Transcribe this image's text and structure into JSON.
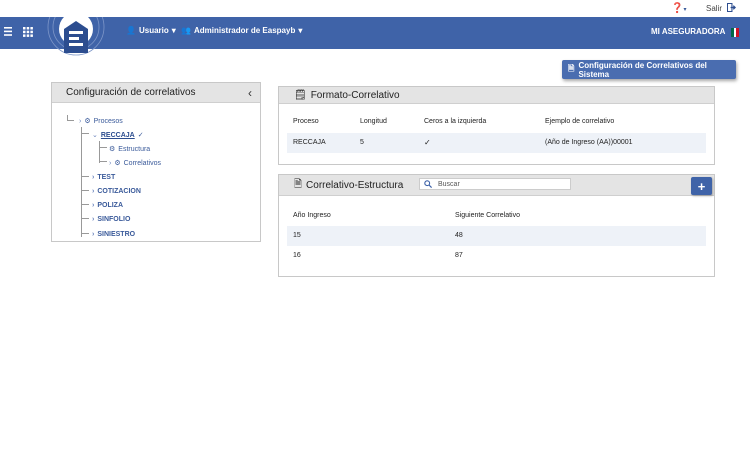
{
  "topbar": {
    "salir_label": "Salir"
  },
  "navbar": {
    "user_label": "Usuario",
    "admin_label": "Administrador de Easpayb",
    "company_label": "MI ASEGURADORA",
    "flag_colors": [
      "#006847",
      "#ffffff",
      "#ce1126"
    ]
  },
  "toolbar": {
    "system_button_label": "Configuración de Correlativos del Sistema"
  },
  "left_panel": {
    "title": "Configuración de correlativos",
    "tree": {
      "procesos": "Procesos",
      "reccaja": "RECCAJA",
      "estructura": "Estructura",
      "correlativos": "Correlativos",
      "items": [
        "TEST",
        "COTIZACION",
        "POLIZA",
        "SINFOLIO",
        "SINIESTRO"
      ]
    }
  },
  "formato": {
    "title": "Formato-Correlativo",
    "headers": {
      "proceso": "Proceso",
      "longitud": "Longitud",
      "ceros": "Ceros a la izquierda",
      "ejemplo": "Ejemplo de correlativo"
    },
    "row": {
      "proceso": "RECCAJA",
      "longitud": "5",
      "ceros": "✓",
      "ejemplo": "(Año de Ingreso (AA))00001"
    }
  },
  "estructura": {
    "title": "Correlativo-Estructura",
    "search_placeholder": "Buscar",
    "add_label": "+",
    "headers": {
      "anio": "Año Ingreso",
      "siguiente": "Siguiente Correlativo"
    },
    "rows": [
      {
        "anio": "15",
        "siguiente": "48"
      },
      {
        "anio": "16",
        "siguiente": "87"
      }
    ]
  }
}
